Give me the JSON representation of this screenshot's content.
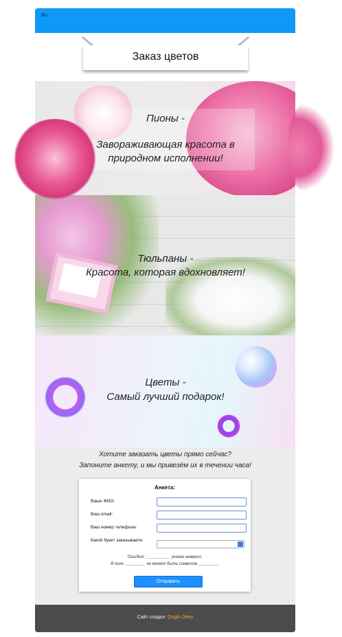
{
  "header": {
    "lang": "Ru",
    "title": "Заказ цветов"
  },
  "banners": [
    {
      "line1": "Пионы -",
      "line2": "Завораживающая красота в",
      "line3": "природном исполнении!"
    },
    {
      "line1": "Тюльпаны -",
      "line2": "Красота, которая вдохновляет!"
    },
    {
      "line1": "Цветы -",
      "line2": "Самый лучший подарок!"
    }
  ],
  "intro": {
    "line1": "Хотите заказать цветы прямо сейчас?",
    "line2": "Запоните анкету, и мы привезём их в течении часа!"
  },
  "form": {
    "title": "Анкета:",
    "fio_label": "Ваше ФИО:",
    "email_label": "Ваш email:",
    "phone_label": "Ваш номер телефона:",
    "bouquet_label": "Какой букет заказываете:",
    "fio_value": "",
    "email_value": "",
    "phone_value": "",
    "bouquet_value": "",
    "error1": "Ошибка! ___________ указан неверно.",
    "error2": "В поле _________ не может быть символов _________",
    "submit": "Отправить"
  },
  "footer": {
    "prefix": "Сайт создал:",
    "author": "Gogik Ortey"
  },
  "colors": {
    "topbar": "#0d99f5",
    "submit": "#1e90ff",
    "footer": "#4b4b4b",
    "author": "#f5a623"
  }
}
